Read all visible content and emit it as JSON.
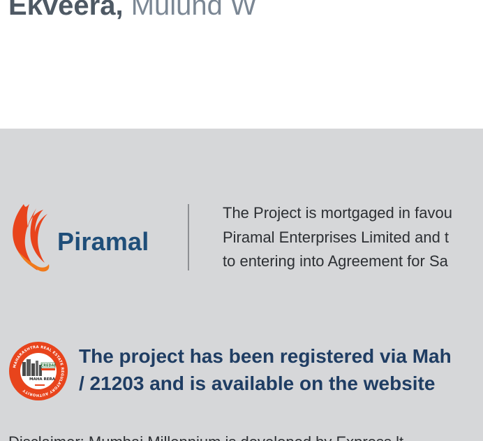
{
  "hero": {
    "title_bold": "Ekveera,",
    "title_light": " Mulund W"
  },
  "footer": {
    "piramal": {
      "brand_name": "Piramal",
      "icon": "piramal-flame-logo",
      "brand_color": "#1f4e79",
      "accent_color": "#e8441c"
    },
    "mortgage_lines": [
      "The Project is mortgaged in favou",
      "Piramal Enterprises Limited and t",
      "to entering into Agreement for Sa"
    ],
    "rera": {
      "badge_icon": "maharera-seal",
      "badge_ring_text": "MAHARASHTRA REAL ESTATE REGULATORY AUTHORITY",
      "badge_label": "MAHA RERA",
      "badge_sub_label": "CREDAI",
      "line1": "The project has been registered via Mah",
      "line2": "/ 21203 and is available on the website"
    },
    "disclaimer": "Disclaimer: Mumbai Millennium is developed by Express lt"
  },
  "colors": {
    "footer_bg": "#d6d7d9",
    "rera_text": "#1f3d63",
    "seal_orange": "#e8441c"
  }
}
